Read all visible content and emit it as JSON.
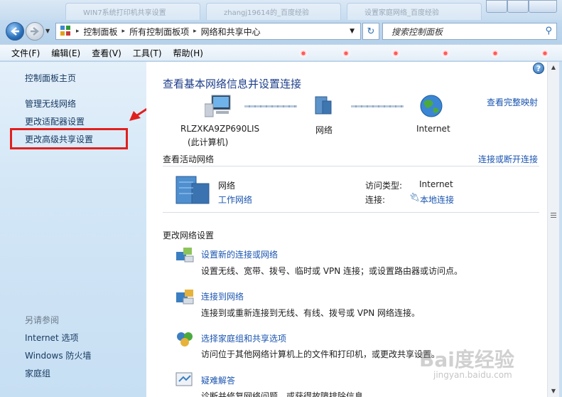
{
  "tabs": [
    "WIN7系统打印机共享设置",
    "zhangj19614的_百度经验",
    "设置家庭网络_百度经验"
  ],
  "address": {
    "crumbs": [
      "控制面板",
      "所有控制面板项",
      "网络和共享中心"
    ],
    "search_placeholder": "搜索控制面板"
  },
  "menu": [
    "文件(F)",
    "编辑(E)",
    "查看(V)",
    "工具(T)",
    "帮助(H)"
  ],
  "sidebar": {
    "home": "控制面板主页",
    "items": [
      "管理无线网络",
      "更改适配器设置",
      "更改高级共享设置"
    ],
    "see_also_label": "另请参阅",
    "see_also": [
      "Internet 选项",
      "Windows 防火墙",
      "家庭组"
    ]
  },
  "main": {
    "title": "查看基本网络信息并设置连接",
    "view_full_map": "查看完整映射",
    "map": {
      "computer_name": "RLZXKA9ZP690LIS",
      "computer_sub": "(此计算机)",
      "network": "网络",
      "internet": "Internet"
    },
    "active_header": "查看活动网络",
    "connect_disconnect": "连接或断开连接",
    "active": {
      "name": "网络",
      "type": "工作网络",
      "access_label": "访问类型:",
      "access_value": "Internet",
      "conn_label": "连接:",
      "conn_value": "本地连接"
    },
    "change_header": "更改网络设置",
    "tasks": [
      {
        "title": "设置新的连接或网络",
        "desc": "设置无线、宽带、拨号、临时或 VPN 连接；或设置路由器或访问点。"
      },
      {
        "title": "连接到网络",
        "desc": "连接到或重新连接到无线、有线、拨号或 VPN 网络连接。"
      },
      {
        "title": "选择家庭组和共享选项",
        "desc": "访问位于其他网络计算机上的文件和打印机，或更改共享设置。"
      },
      {
        "title": "疑难解答",
        "desc": "诊断并修复网络问题，或获得故障排除信息。"
      }
    ]
  },
  "watermark": {
    "brand": "Bai度经验",
    "url": "jingyan.baidu.com"
  },
  "colors": {
    "link": "#1a55b0",
    "title": "#1e3e8a",
    "highlight": "#e0201e"
  }
}
